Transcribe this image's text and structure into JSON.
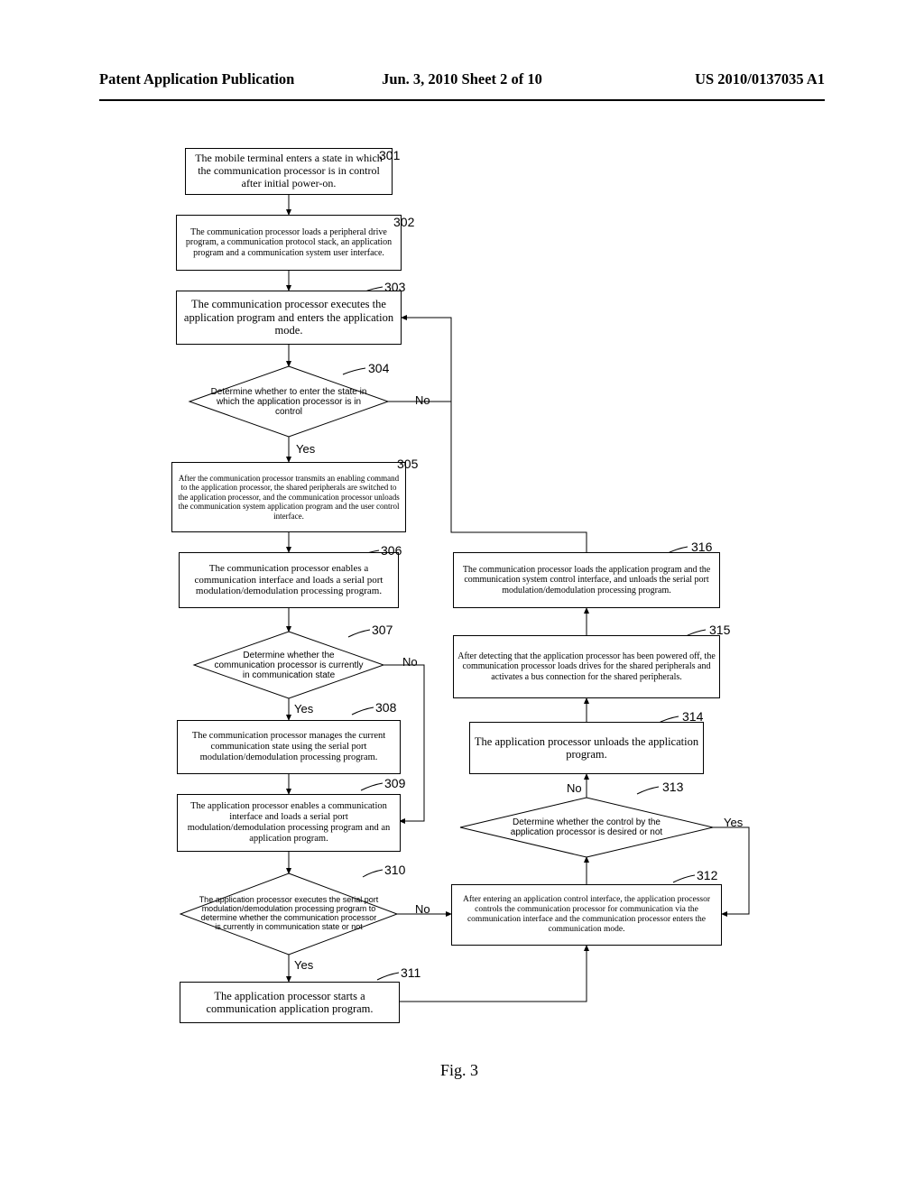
{
  "header": {
    "left": "Patent Application Publication",
    "center": "Jun. 3, 2010   Sheet 2 of 10",
    "right": "US 2010/0137035 A1"
  },
  "figure_caption": "Fig. 3",
  "labels": {
    "yes": "Yes",
    "no": "No"
  },
  "refs": {
    "r301": "301",
    "r302": "302",
    "r303": "303",
    "r304": "304",
    "r305": "305",
    "r306": "306",
    "r307": "307",
    "r308": "308",
    "r309": "309",
    "r310": "310",
    "r311": "311",
    "r312": "312",
    "r313": "313",
    "r314": "314",
    "r315": "315",
    "r316": "316"
  },
  "boxes": {
    "b301": "The mobile terminal enters a state in which the communication processor is in control after initial power-on.",
    "b302": "The communication processor loads a peripheral drive program, a communication protocol stack, an application program and a communication system user interface.",
    "b303": "The communication processor executes the application program and enters the application mode.",
    "b305": "After the communication processor transmits an enabling command to the application processor, the shared peripherals are switched to the application processor, and the communication processor unloads the communication system application program and the user control interface.",
    "b306": "The communication processor enables a communication interface and loads a serial port modulation/demodulation processing program.",
    "b308": "The communication processor manages the current communication state using the serial port modulation/demodulation processing program.",
    "b309": "The application processor enables a communication interface and loads a serial port modulation/demodulation processing program and an application program.",
    "b311": "The application processor starts a communication application program.",
    "b312": "After entering an application control interface, the application processor controls the communication processor for communication via the communication interface and the communication processor enters the communication mode.",
    "b314": "The application processor unloads the application program.",
    "b315": "After detecting that the application processor has been powered off, the communication processor loads drives for the shared peripherals and activates a bus connection for the shared peripherals.",
    "b316": "The communication processor loads the application program and the communication system control interface, and unloads the serial port modulation/demodulation processing program."
  },
  "diamonds": {
    "d304": "Determine whether to enter the state in which the application processor is in control",
    "d307": "Determine whether the communication processor is currently in communication state",
    "d310": "The application processor executes the serial port modulation/demodulation processing program to determine whether the communication processor is currently in communication state or not",
    "d313": "Determine whether the control by the application processor is desired or not"
  }
}
